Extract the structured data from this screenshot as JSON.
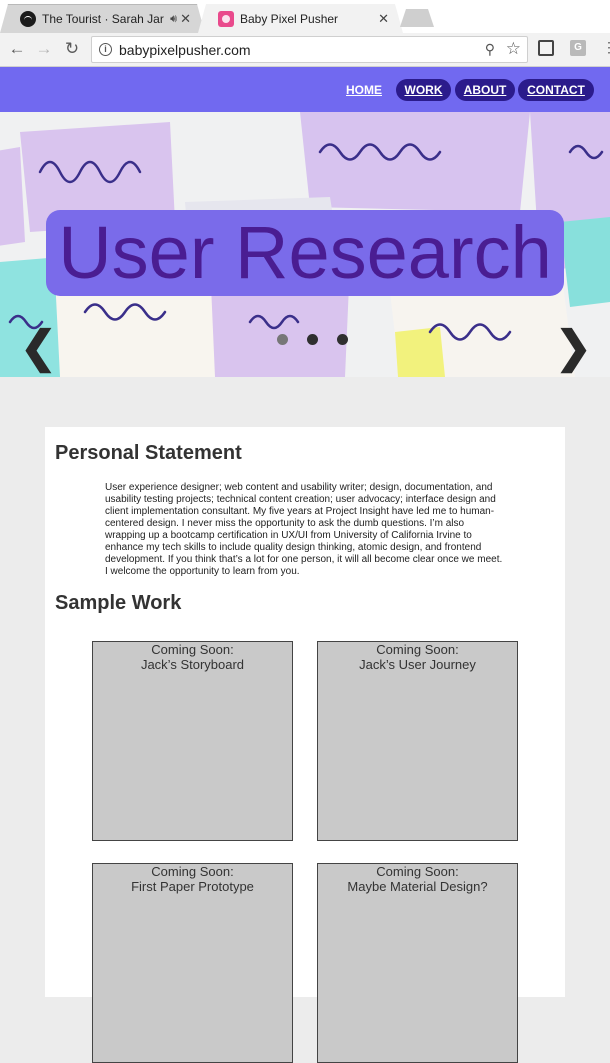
{
  "browser": {
    "tabs": [
      {
        "title": "The Tourist · Sarah Jar",
        "active": false,
        "audio": true
      },
      {
        "title": "Baby Pixel Pusher",
        "active": true,
        "audio": false
      }
    ],
    "url": "babypixelpusher.com",
    "nav": {
      "back": "←",
      "forward": "→",
      "reload": "↻"
    },
    "ext_g": "G"
  },
  "site": {
    "nav": [
      {
        "label": "HOME",
        "style": "plain"
      },
      {
        "label": "WORK",
        "style": "pill"
      },
      {
        "label": "ABOUT",
        "style": "pill"
      },
      {
        "label": "CONTACT",
        "style": "pill"
      }
    ],
    "colors": {
      "header": "#7169f0",
      "pill": "#2b1b8c",
      "hero_title_bg": "#7a6bea",
      "hero_title_text": "#4a1d92"
    }
  },
  "hero": {
    "title": "User Research",
    "prev": "❮",
    "next": "❯",
    "slides": 3,
    "active_slide": 1
  },
  "personal_statement": {
    "heading": "Personal Statement",
    "body": "User experience designer; web content and usability writer; design, documentation, and usability testing projects; technical content creation; user advocacy; interface design and client implementation consultant. My five years at Project Insight have led me to human-centered design. I never miss the opportunity to ask the dumb questions. I’m also wrapping up a bootcamp certification in UX/UI from University of California Irvine to enhance my tech skills to include quality design thinking, atomic design, and frontend development. If you think that’s a lot for one person, it will all become clear once we meet. I welcome the opportunity to learn from you."
  },
  "sample_work": {
    "heading": "Sample Work",
    "items": [
      {
        "line1": "Coming Soon:",
        "line2": "Jack’s Storyboard"
      },
      {
        "line1": "Coming Soon:",
        "line2": "Jack’s User Journey"
      },
      {
        "line1": "Coming Soon:",
        "line2": "First Paper Prototype"
      },
      {
        "line1": "Coming Soon:",
        "line2": "Maybe Material Design?"
      }
    ]
  }
}
